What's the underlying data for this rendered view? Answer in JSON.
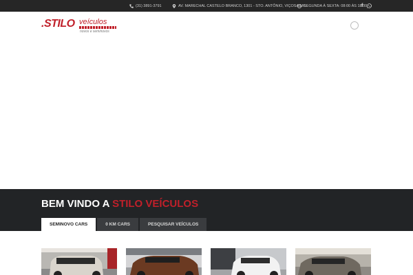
{
  "topbar": {
    "phone": "(31) 3891-3791",
    "address": "AV. MARECHAL CASTELO BRANCO, 1301 - STO. ANTÔNIO, VIÇOSA-MG",
    "hours": "SEGUNDA À SEXTA: 08:00 ÀS 18:00",
    "social": {
      "facebook": "f",
      "whatsapp": "whatsapp-icon"
    }
  },
  "logo": {
    "brand": ".STILO",
    "word": "veículos",
    "tagline": "novos e seminovos"
  },
  "welcome": {
    "prefix": "BEM VINDO A ",
    "brand": "STILO VEÍCULOS"
  },
  "tabs": [
    {
      "label": "SEMINOVO CARS",
      "active": true
    },
    {
      "label": "0 KM CARS",
      "active": false
    },
    {
      "label": "PESQUISAR VEÍCULOS",
      "active": false
    }
  ],
  "cards": [
    {
      "car_color": "#d9d4cc"
    },
    {
      "car_color": "#6b3a22"
    },
    {
      "car_color": "#f2f2f2"
    },
    {
      "car_color": "#6f6960"
    }
  ],
  "colors": {
    "accent": "#c0202a",
    "dark": "#222426",
    "topbar": "#262626"
  }
}
